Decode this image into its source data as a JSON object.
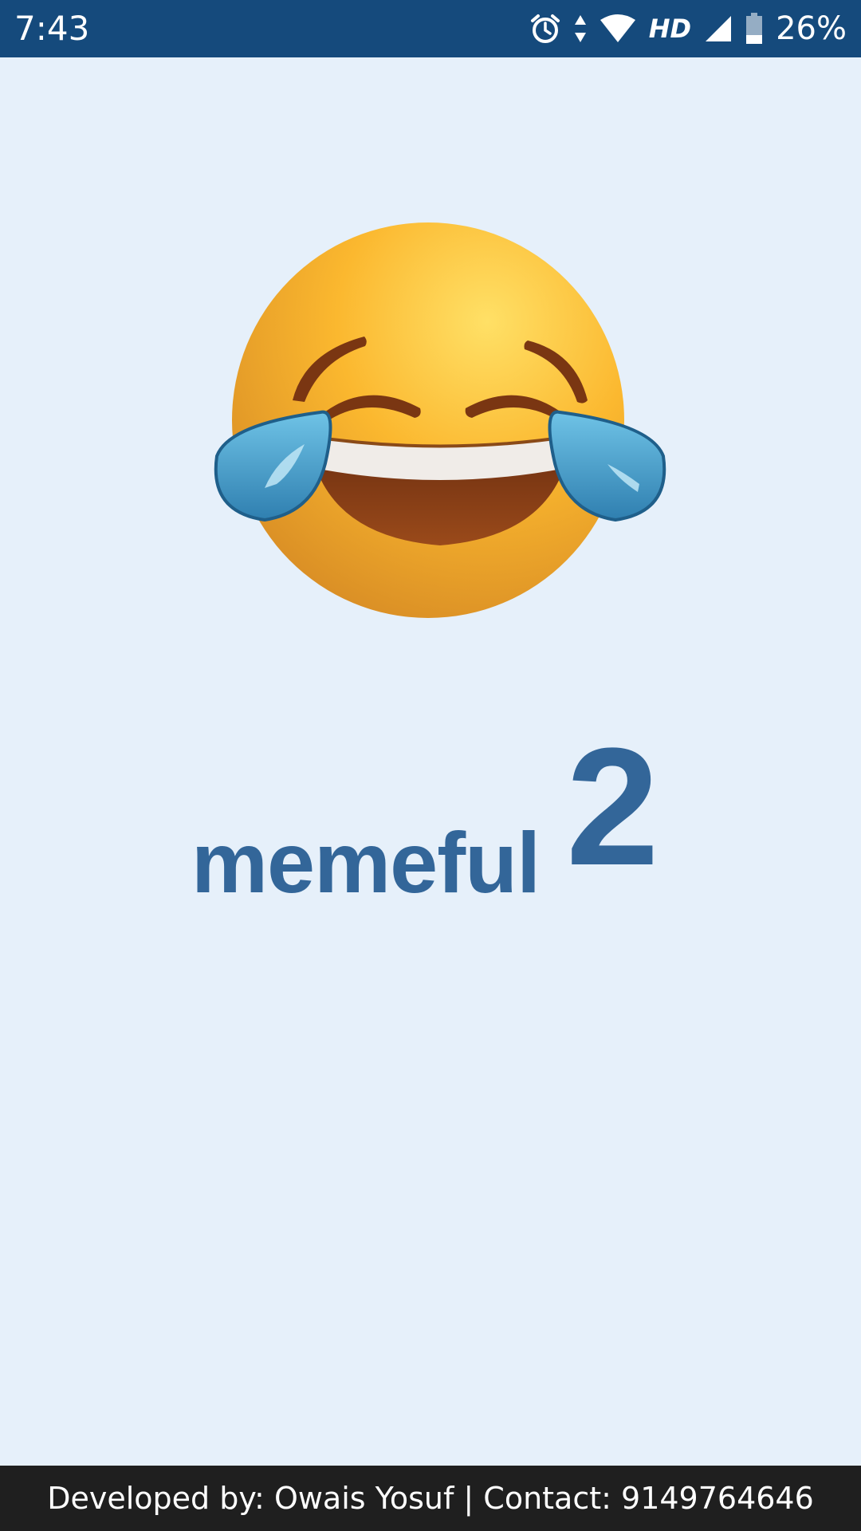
{
  "status_bar": {
    "time": "7:43",
    "icons": [
      "alarm-icon",
      "data-arrows-icon",
      "wifi-icon",
      "hd-label",
      "cell-signal-icon",
      "battery-icon"
    ],
    "hd_label": "HD",
    "battery_percent": "26%",
    "background_color": "#154a7c"
  },
  "splash": {
    "emoji": "face-with-tears-of-joy",
    "app_name": "memeful",
    "version_number": "2",
    "brand_color": "#336699",
    "background_color": "#e6f0fa"
  },
  "footer": {
    "text": "Developed by: Owais Yosuf | Contact: 9149764646",
    "background_color": "#1f1f1f"
  }
}
